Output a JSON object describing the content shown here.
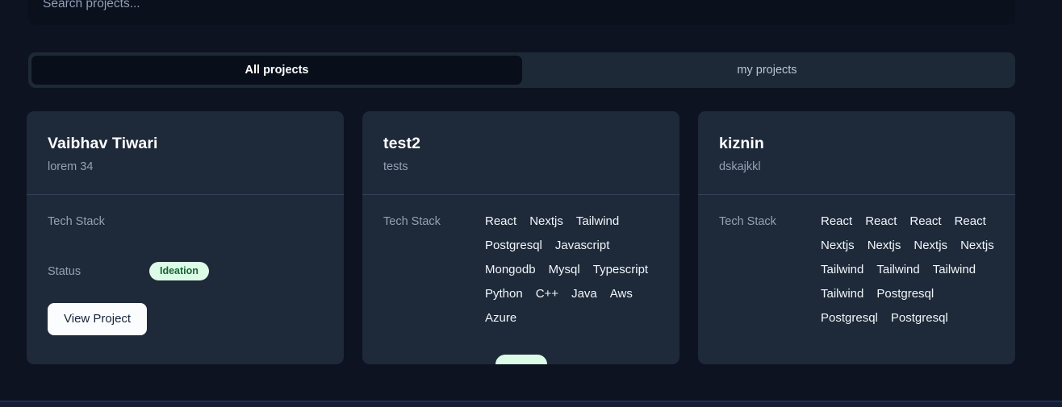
{
  "search": {
    "placeholder": "Search projects...",
    "value": ""
  },
  "tabs": {
    "all_label": "All projects",
    "my_label": "my projects",
    "active": "All projects"
  },
  "labels": {
    "tech_stack": "Tech Stack",
    "status": "Status",
    "view_project": "View Project"
  },
  "colors": {
    "page_bg": "#0d1320",
    "card_bg": "#1e2939",
    "active_tab_bg": "#080e1a",
    "badge_bg": "#dcfce7",
    "badge_text": "#166534",
    "button_bg": "#fbfcfd",
    "muted_text": "#93a2b5"
  },
  "projects": [
    {
      "title": "Vaibhav Tiwari",
      "subtitle": "lorem 34",
      "tech": [],
      "status": "Ideation",
      "action": "View Project"
    },
    {
      "title": "test2",
      "subtitle": "tests",
      "tech": [
        "React",
        "Nextjs",
        "Tailwind",
        "Postgresql",
        "Javascript",
        "Mongodb",
        "Mysql",
        "Typescript",
        "Python",
        "C++",
        "Java",
        "Aws",
        "Azure"
      ],
      "status": "",
      "action": ""
    },
    {
      "title": "kiznin",
      "subtitle": "dskajkkl",
      "tech": [
        "React",
        "React",
        "React",
        "React",
        "Nextjs",
        "Nextjs",
        "Nextjs",
        "Nextjs",
        "Tailwind",
        "Tailwind",
        "Tailwind",
        "Tailwind",
        "Postgresql",
        "Postgresql",
        "Postgresql"
      ],
      "status": "",
      "action": ""
    }
  ]
}
